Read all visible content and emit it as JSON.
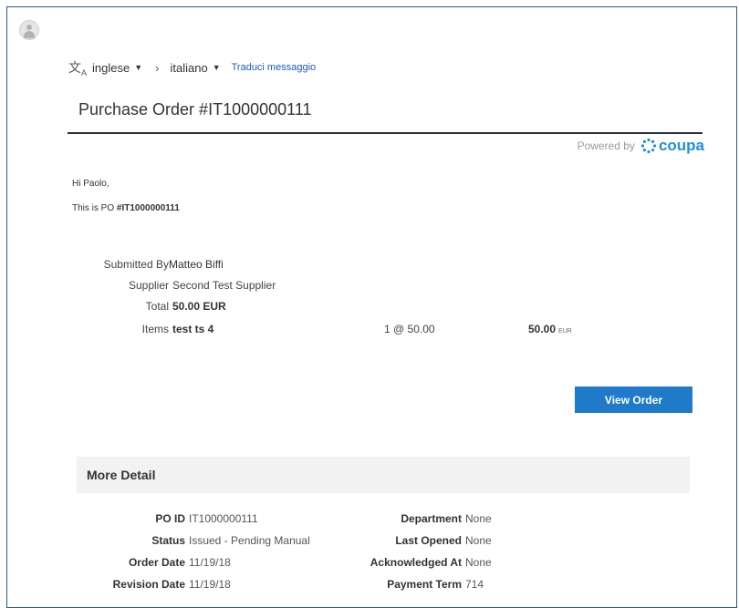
{
  "translate": {
    "source_lang": "inglese",
    "target_lang": "italiano",
    "translate_link": "Traduci messaggio"
  },
  "title": "Purchase Order #IT1000000111",
  "powered": {
    "prefix": "Powered by",
    "brand": "coupa"
  },
  "greeting": "Hi Paolo,",
  "intro": {
    "prefix": "This is PO",
    "po": "#IT1000000111"
  },
  "summary": {
    "submitted_by_label": "Submitted By",
    "submitted_by": "Matteo Biffi",
    "supplier_label": "Supplier",
    "supplier": "Second Test Supplier",
    "total_label": "Total",
    "total": "50.00 EUR",
    "items_label": "Items",
    "item_name": "test ts 4",
    "item_qty": "1 @ 50.00",
    "item_amount": "50.00",
    "item_currency": "EUR"
  },
  "view_order_button": "View Order",
  "more_detail": {
    "title": "More Detail",
    "left": [
      {
        "label": "PO ID",
        "value": "IT1000000111"
      },
      {
        "label": "Status",
        "value": "Issued - Pending Manual"
      },
      {
        "label": "Order Date",
        "value": "11/19/18"
      },
      {
        "label": "Revision Date",
        "value": "11/19/18"
      }
    ],
    "right": [
      {
        "label": "Department",
        "value": "None"
      },
      {
        "label": "Last Opened",
        "value": "None"
      },
      {
        "label": "Acknowledged At",
        "value": "None"
      },
      {
        "label": "Payment Term",
        "value": "714"
      }
    ]
  },
  "colors": {
    "accent": "#1f7ac9",
    "link": "#1a5bbf",
    "rule": "#2d2d3a",
    "panel": "#f2f2f2"
  },
  "icons": {
    "avatar": "user-avatar-icon",
    "translate": "translate-icon",
    "brand": "coupa-logo-icon"
  }
}
